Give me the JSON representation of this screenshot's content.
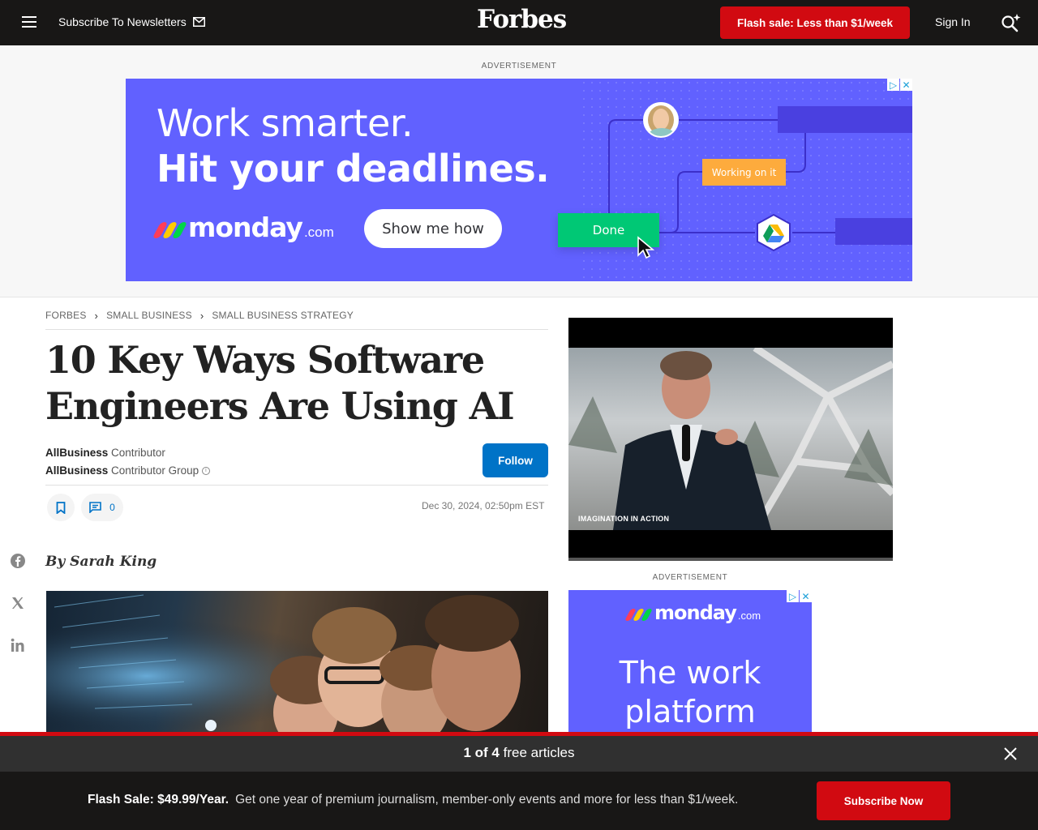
{
  "nav": {
    "newsletter_label": "Subscribe To Newsletters",
    "logo": "Forbes",
    "flash_sale": "Flash sale: Less than $1/week",
    "sign_in": "Sign In"
  },
  "top_ad": {
    "label": "ADVERTISEMENT",
    "headline_1": "Work smarter.",
    "headline_2": "Hit your deadlines.",
    "brand": "monday",
    "brand_suffix": ".com",
    "cta": "Show me how",
    "status_done": "Done",
    "status_working": "Working on it",
    "brand_colors": [
      "#ff3d57",
      "#ffcb00",
      "#00d647"
    ]
  },
  "breadcrumb": [
    "FORBES",
    "SMALL BUSINESS",
    "SMALL BUSINESS STRATEGY"
  ],
  "article": {
    "title": "10 Key Ways Software Engineers Are Using AI",
    "author_1_name": "AllBusiness",
    "author_1_role": "Contributor",
    "author_2_name": "AllBusiness",
    "author_2_role": "Contributor Group",
    "follow": "Follow",
    "comment_count": "0",
    "timestamp": "Dec 30, 2024, 02:50pm EST",
    "byline": "By Sarah King"
  },
  "video": {
    "caption": "IMAGINATION IN ACTION"
  },
  "side_ad": {
    "label": "ADVERTISEMENT",
    "brand": "monday",
    "brand_suffix": ".com",
    "text": "The work platform"
  },
  "meter": {
    "count": "1 of 4",
    "text": "free articles"
  },
  "promo": {
    "bold": "Flash Sale: $49.99/Year.",
    "text": "Get one year of premium journalism, member-only events and more for less than $1/week.",
    "button": "Subscribe Now"
  },
  "colors": {
    "forbes_red": "#d10a11",
    "follow_blue": "#0073c7",
    "monday_purple": "#6161ff"
  }
}
